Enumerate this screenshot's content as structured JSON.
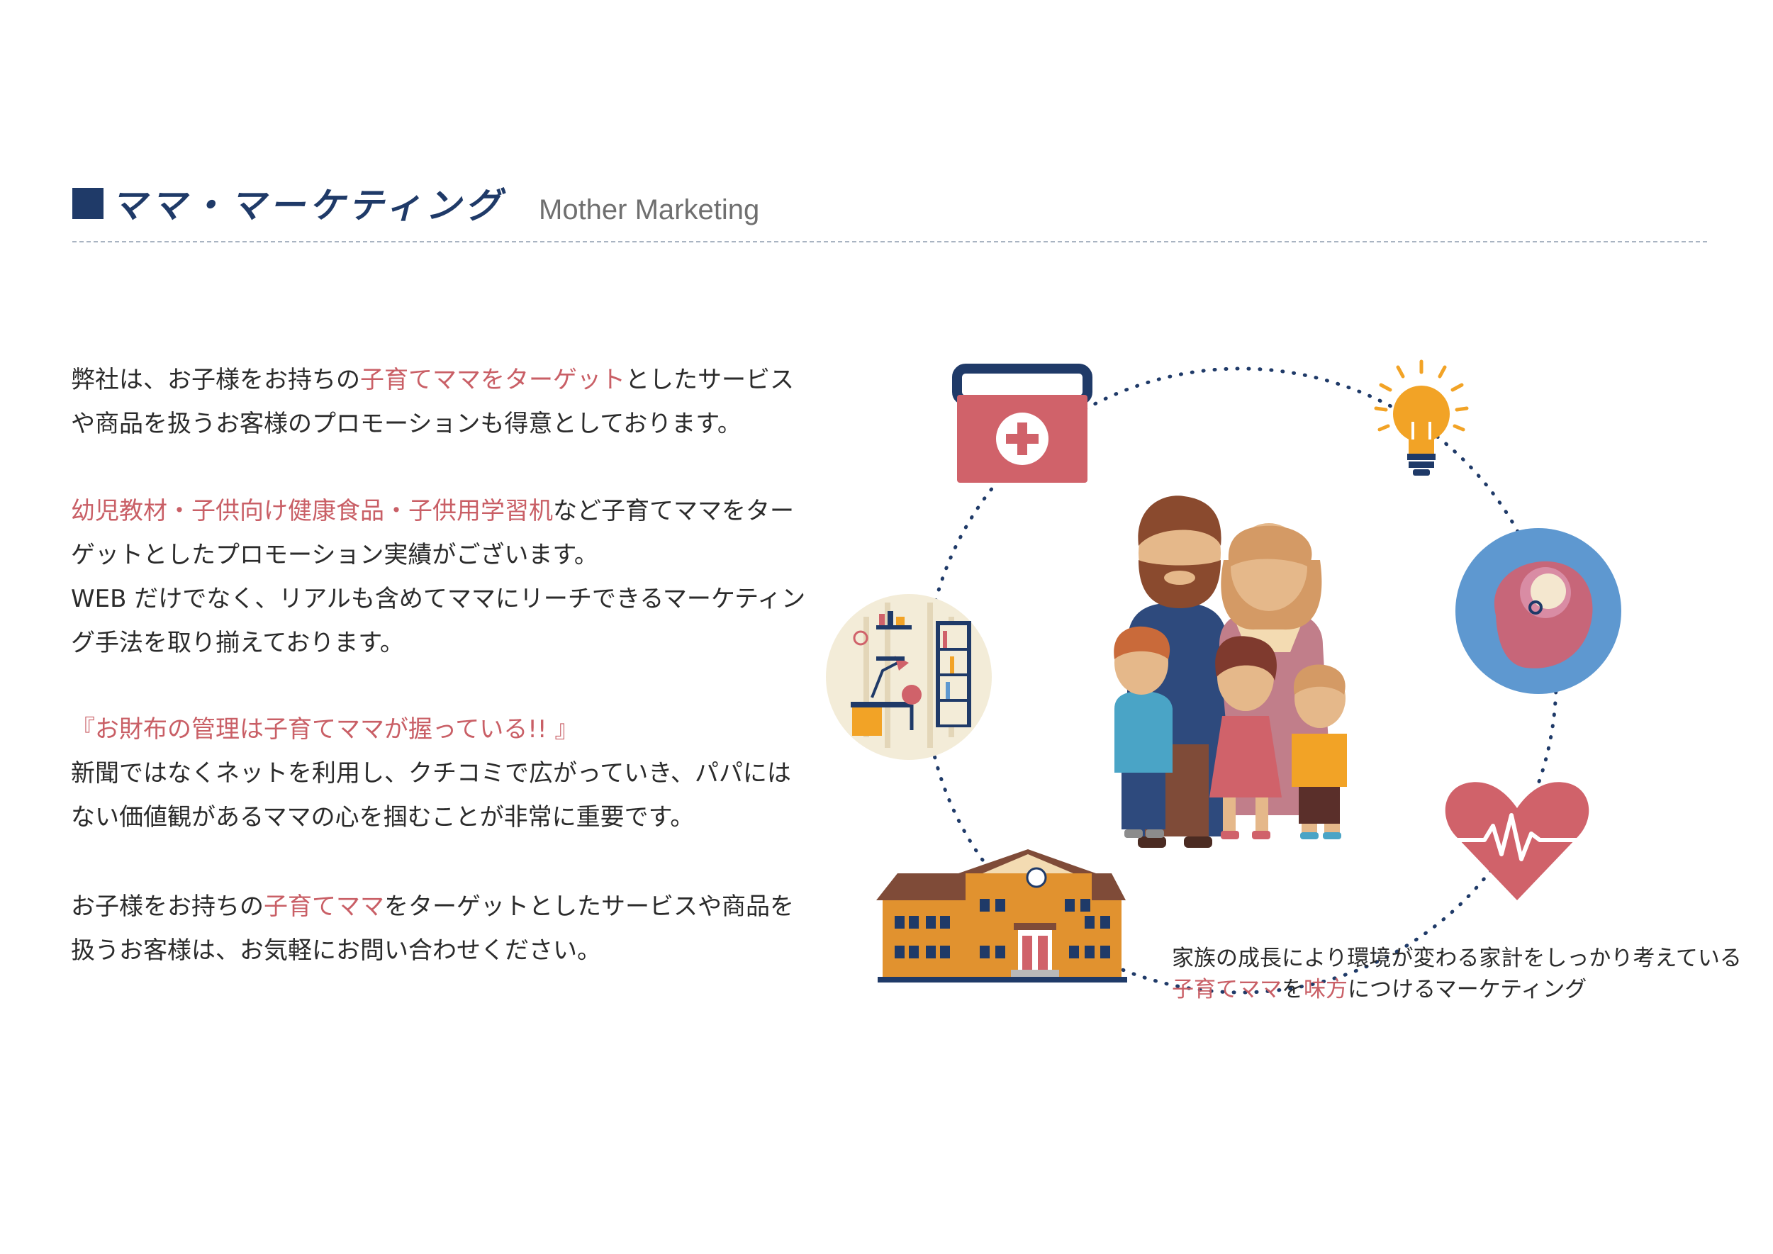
{
  "header": {
    "title_ja": "ママ・マーケティング",
    "title_en": "Mother Marketing"
  },
  "paragraphs": {
    "p1": {
      "l1_a": "弊社は、お子様をお持ちの",
      "l1_accent": "子育てママをターゲット",
      "l1_b": "としたサービス",
      "l2": "や商品を扱うお客様のプロモーションも得意としております。"
    },
    "p2": {
      "l1_accent": "幼児教材・子供向け健康食品・子供用学習机",
      "l1_b": "など子育てママをター",
      "l2": "ゲットとしたプロモーション実績がございます。",
      "l3": "WEB だけでなく、リアルも含めてママにリーチできるマーケティン",
      "l4": "グ手法を取り揃えております。"
    },
    "p3": {
      "l1_accent": "『お財布の管理は子育てママが握っている!! 』",
      "l2": "新聞ではなくネットを利用し、クチコミで広がっていき、パパには",
      "l3": "ない価値観があるママの心を掴むことが非常に重要です。"
    },
    "p4": {
      "l1_a": "お子様をお持ちの",
      "l1_accent": "子育てママ",
      "l1_b": "をターゲットとしたサービスや商品を",
      "l2": "扱うお客様は、お気軽にお問い合わせください。"
    }
  },
  "caption": {
    "l1": "家族の成長により環境が変わる家計をしっかり考えている",
    "l2_accent1": "子育てママ",
    "l2_a": "を",
    "l2_accent2": "味方",
    "l2_b": "につけるマーケティング"
  },
  "icons": [
    "first-aid-kit-icon",
    "light-bulb-icon",
    "baby-icon",
    "heart-pulse-icon",
    "school-building-icon",
    "study-desk-icon",
    "family-icon"
  ],
  "colors": {
    "navy": "#1f3a68",
    "accent": "#c95f66",
    "gray": "#6f6f6f"
  }
}
